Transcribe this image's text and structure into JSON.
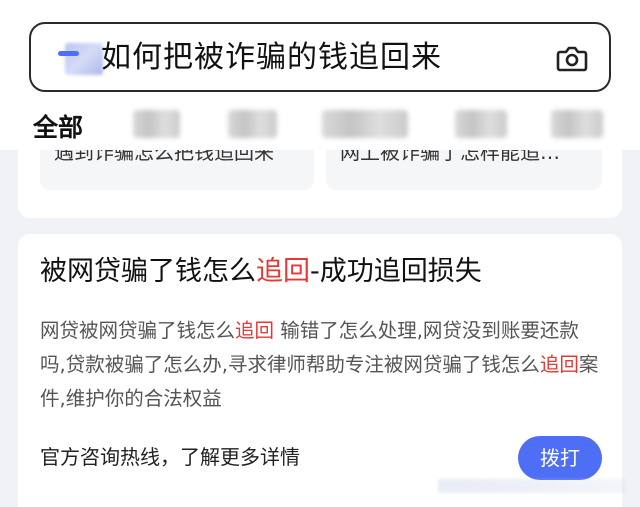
{
  "search": {
    "query": "如何把被诈骗的钱追回来",
    "query_icon": "blurred-image",
    "camera_icon": "camera-icon"
  },
  "tabs": {
    "active_label": "全部",
    "blurred_count": 5
  },
  "previous_card": {
    "chip_1": "遇到诈骗怎么把钱追回来",
    "chip_2": "网上被诈骗了怎样能追…"
  },
  "result": {
    "title_part1": "被网贷骗了钱怎么",
    "title_highlight": "追回",
    "title_part2": "-成功追回损失",
    "desc_part1": "网贷被网贷骗了钱怎么",
    "desc_highlight1": "追回",
    "desc_part2": " 输错了怎么处理,网贷没到账要还款吗,贷款被骗了怎么办,寻求律师帮助专注被网贷骗了钱怎么",
    "desc_highlight2": "追回",
    "desc_part3": "案件,维护你的合法权益",
    "hotline_text": "官方咨询热线，了解更多详情",
    "call_button": "拨打"
  },
  "colors": {
    "accent": "#4d6ef5",
    "highlight": "#e53935",
    "background": "#f1f2f5"
  }
}
